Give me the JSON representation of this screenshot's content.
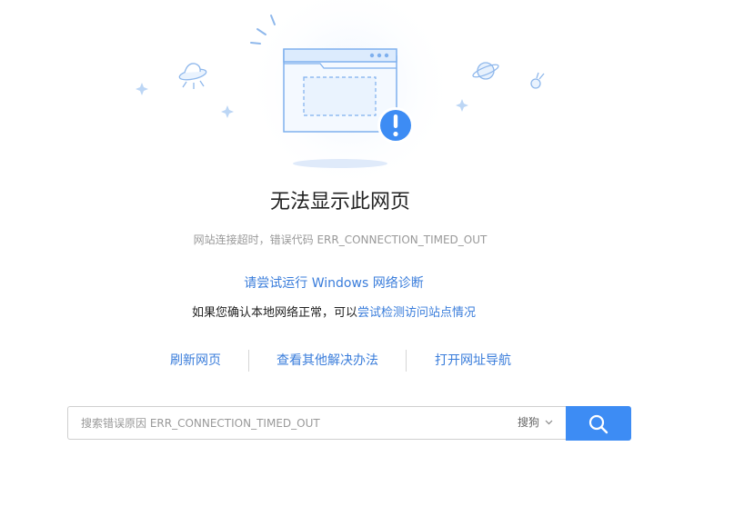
{
  "error": {
    "title": "无法显示此网页",
    "subtitle": "网站连接超时，错误代码 ERR_CONNECTION_TIMED_OUT"
  },
  "suggestions": {
    "diagnose_link": "请尝试运行 Windows 网络诊断",
    "check_prefix": "如果您确认本地网络正常，可以",
    "check_link": "尝试检测访问站点情况"
  },
  "actions": {
    "refresh": "刷新网页",
    "other_solutions": "查看其他解决办法",
    "open_nav": "打开网址导航"
  },
  "search": {
    "placeholder": "搜索错误原因 ERR_CONNECTION_TIMED_OUT",
    "engine": "搜狗",
    "button_icon": "search-icon"
  },
  "colors": {
    "link": "#3a7ddb",
    "button": "#3d8cf4",
    "alert": "#3d8cf4"
  }
}
